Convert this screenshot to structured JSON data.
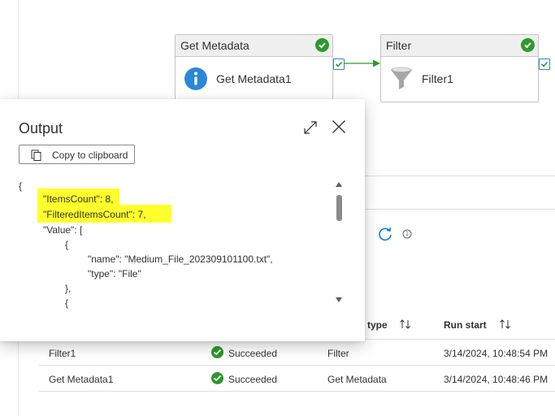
{
  "pipeline": {
    "activities": [
      {
        "header": "Get Metadata",
        "name": "Get Metadata1",
        "icon": "info-icon"
      },
      {
        "header": "Filter",
        "name": "Filter1",
        "icon": "funnel-icon"
      }
    ]
  },
  "output_panel": {
    "title": "Output",
    "copy_label": "Copy to clipboard",
    "json_lines": [
      "{",
      "\"ItemsCount\": 8,",
      "\"FilteredItemsCount\": 7,",
      "\"Value\": [",
      "{",
      "\"name\": \"Medium_File_202309101100.txt\",",
      "\"type\": \"File\"",
      "},",
      "{"
    ]
  },
  "runs": {
    "columns": [
      "type",
      "Run start"
    ],
    "rows": [
      {
        "activity": "Filter1",
        "status": "Succeeded",
        "type": "Filter",
        "run_start": "3/14/2024, 10:48:54 PM"
      },
      {
        "activity": "Get Metadata1",
        "status": "Succeeded",
        "type": "Get Metadata",
        "run_start": "3/14/2024, 10:48:46 PM"
      }
    ]
  },
  "colors": {
    "success": "#2c9a2c",
    "accent": "#0078d4",
    "highlight": "#ffff2b"
  }
}
